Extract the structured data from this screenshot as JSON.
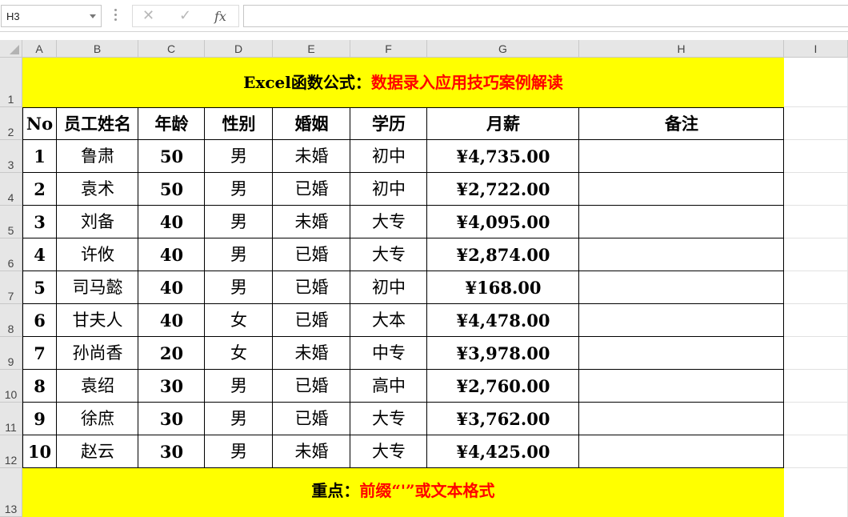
{
  "formula_bar": {
    "name_box": "H3",
    "cancel_icon": "✕",
    "enter_icon": "✓",
    "fx_label": "fx",
    "formula": ""
  },
  "columns": [
    "A",
    "B",
    "C",
    "D",
    "E",
    "F",
    "G",
    "H",
    "I"
  ],
  "rows": [
    "1",
    "2",
    "3",
    "4",
    "5",
    "6",
    "7",
    "8",
    "9",
    "10",
    "11",
    "12",
    "13"
  ],
  "title_banner": {
    "black": "Excel函数公式：",
    "red": "数据录入应用技巧案例解读"
  },
  "table": {
    "headers": [
      "No",
      "员工姓名",
      "年龄",
      "性别",
      "婚姻",
      "学历",
      "月薪",
      "备注"
    ],
    "rows": [
      [
        "1",
        "鲁肃",
        "50",
        "男",
        "未婚",
        "初中",
        "¥4,735.00",
        ""
      ],
      [
        "2",
        "袁术",
        "50",
        "男",
        "已婚",
        "初中",
        "¥2,722.00",
        ""
      ],
      [
        "3",
        "刘备",
        "40",
        "男",
        "未婚",
        "大专",
        "¥4,095.00",
        ""
      ],
      [
        "4",
        "许攸",
        "40",
        "男",
        "已婚",
        "大专",
        "¥2,874.00",
        ""
      ],
      [
        "5",
        "司马懿",
        "40",
        "男",
        "已婚",
        "初中",
        "¥168.00",
        ""
      ],
      [
        "6",
        "甘夫人",
        "40",
        "女",
        "已婚",
        "大本",
        "¥4,478.00",
        ""
      ],
      [
        "7",
        "孙尚香",
        "20",
        "女",
        "未婚",
        "中专",
        "¥3,978.00",
        ""
      ],
      [
        "8",
        "袁绍",
        "30",
        "男",
        "已婚",
        "高中",
        "¥2,760.00",
        ""
      ],
      [
        "9",
        "徐庶",
        "30",
        "男",
        "已婚",
        "大专",
        "¥3,762.00",
        ""
      ],
      [
        "10",
        "赵云",
        "30",
        "男",
        "未婚",
        "大专",
        "¥4,425.00",
        ""
      ]
    ]
  },
  "note_banner": {
    "black": "重点：",
    "red": "前缀“'”或文本格式"
  },
  "colors": {
    "banner_bg": "#ffff00",
    "red_text": "#ff0000",
    "header_bg": "#e6e6e6"
  }
}
